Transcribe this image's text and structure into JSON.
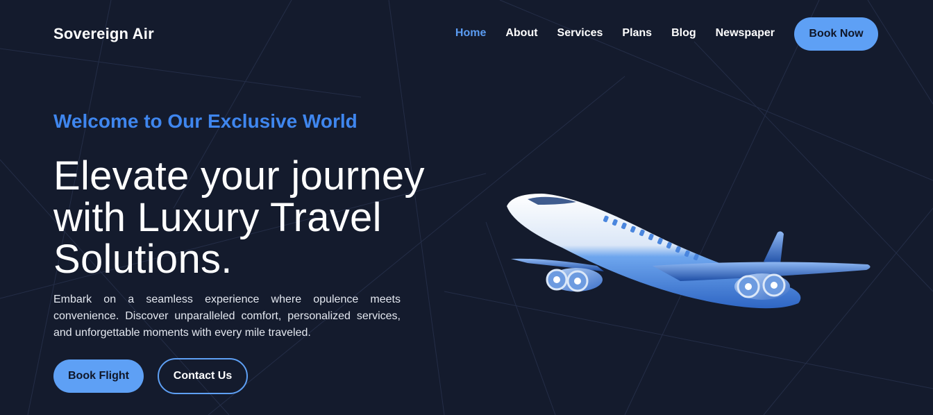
{
  "header": {
    "brand": "Sovereign Air",
    "nav": [
      {
        "label": "Home",
        "active": true
      },
      {
        "label": "About"
      },
      {
        "label": "Services"
      },
      {
        "label": "Plans"
      },
      {
        "label": "Blog"
      },
      {
        "label": "Newspaper"
      }
    ],
    "cta_label": "Book Now"
  },
  "hero": {
    "eyebrow": "Welcome to Our Exclusive World",
    "headline": "Elevate your journey with Luxury Travel Solutions.",
    "description": "Embark on a seamless experience where opulence meets convenience. Discover unparalleled comfort, personalized services, and unforgettable moments with every mile traveled.",
    "primary_button": "Book Flight",
    "secondary_button": "Contact Us",
    "illustration": "airplane-illustration"
  },
  "colors": {
    "background": "#141b2d",
    "accent": "#5ea0f5",
    "eyebrow": "#3f86ee",
    "active_nav": "#5b9cf2"
  }
}
